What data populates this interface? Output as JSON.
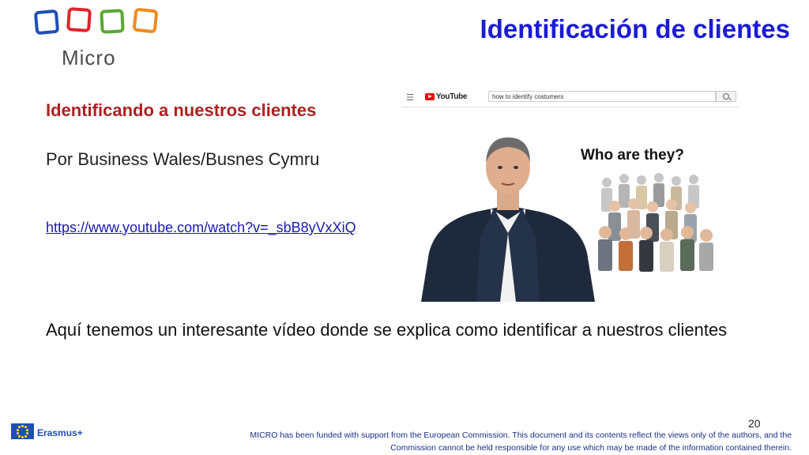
{
  "logo": {
    "brand": "Micro"
  },
  "slide": {
    "title": "Identificación de clientes",
    "subtitle": "Identificando a nuestros clientes",
    "author": "Por Business Wales/Busnes Cymru",
    "link": "https://www.youtube.com/watch?v=_sbB8yVxXiQ",
    "description": "Aquí tenemos un interesante vídeo donde se explica como identificar a nuestros clientes"
  },
  "video": {
    "yt_brand": "YouTube",
    "search_value": "how to identify costumers",
    "caption": "Who are they?"
  },
  "footer": {
    "erasmus": "Erasmus+",
    "page_number": "20",
    "disclaimer": "MICRO has been funded with support from the European Commission. This document and its contents reflect the views only of the authors, and the Commission cannot be held responsible for any use which may be made of the information contained therein."
  },
  "colors": {
    "title": "#1a1ad6",
    "subtitle": "#b01f1f",
    "link": "#1a1ab0",
    "eu_blue": "#1f4fb5"
  }
}
